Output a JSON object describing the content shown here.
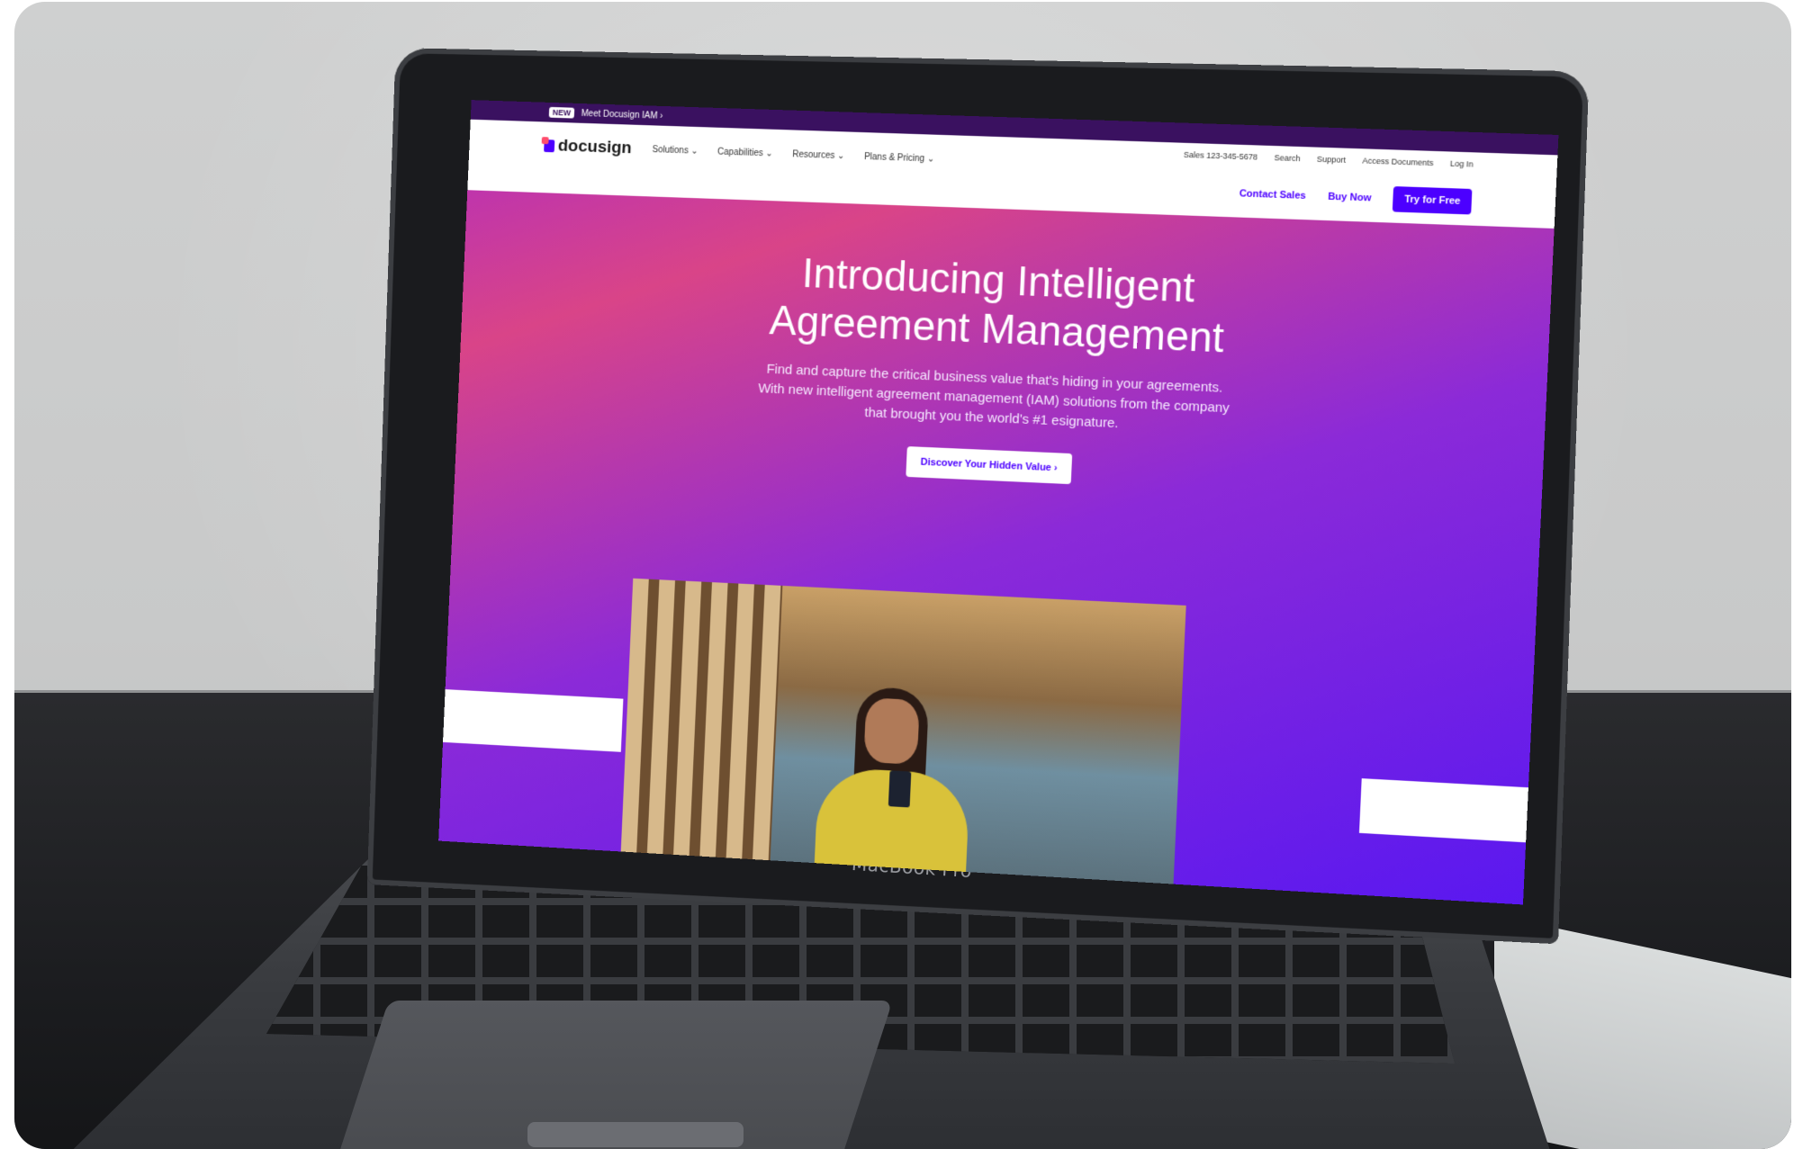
{
  "topbar": {
    "badge": "NEW",
    "link": "Meet Docusign IAM ›"
  },
  "nav": {
    "logo": "docusign",
    "menu": [
      "Solutions ⌄",
      "Capabilities ⌄",
      "Resources ⌄",
      "Plans & Pricing ⌄"
    ],
    "utility": [
      "Sales 123-345-5678",
      "Search",
      "Support",
      "Access Documents",
      "Log In"
    ],
    "contact_sales": "Contact Sales",
    "buy_now": "Buy Now",
    "try_free": "Try for Free"
  },
  "hero": {
    "title": "Introducing Intelligent Agreement Management",
    "text": "Find and capture the critical business value that's hiding in your agreements. With new intelligent agreement management (IAM) solutions from the company that brought you the world's #1 esignature.",
    "button": "Discover Your Hidden Value ›"
  },
  "device": {
    "brand": "MacBook Pro"
  },
  "colors": {
    "accent": "#4c00ff",
    "gradient_start": "#d94488",
    "gradient_end": "#5a18f0"
  }
}
